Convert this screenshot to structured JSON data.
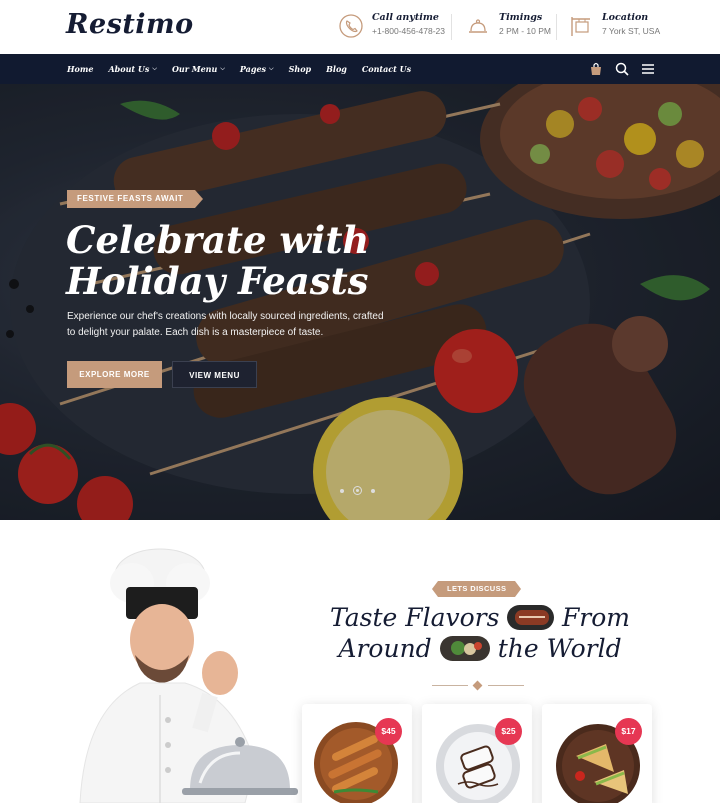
{
  "brand": {
    "logo": "Restimo"
  },
  "contact": [
    {
      "icon": "phone-icon",
      "title": "Call anytime",
      "value": "+1-800-456-478-23"
    },
    {
      "icon": "cloche-icon",
      "title": "Timings",
      "value": "2 PM - 10 PM"
    },
    {
      "icon": "signboard-icon",
      "title": "Location",
      "value": "7 York ST, USA"
    }
  ],
  "nav": {
    "items": [
      {
        "label": "Home",
        "has_dropdown": false
      },
      {
        "label": "About Us",
        "has_dropdown": true
      },
      {
        "label": "Our Menu",
        "has_dropdown": true
      },
      {
        "label": "Pages",
        "has_dropdown": true
      },
      {
        "label": "Shop",
        "has_dropdown": false
      },
      {
        "label": "Blog",
        "has_dropdown": false
      },
      {
        "label": "Contact Us",
        "has_dropdown": false
      }
    ],
    "tools": [
      "cart-icon",
      "search-icon",
      "menu-icon"
    ],
    "background": "#111a30"
  },
  "hero": {
    "badge": "FESTIVE FEASTS AWAIT",
    "title_line1": "Celebrate with",
    "title_line2": "Holiday Feasts",
    "description": "Experience our chef's creations with locally sourced ingredients, crafted to delight your palate. Each dish is a masterpiece of taste.",
    "primary_button": "EXPLORE MORE",
    "secondary_button": "VIEW MENU",
    "slides_total": 3,
    "active_slide": 2
  },
  "section": {
    "tag": "LETS DISCUSS",
    "title_part1": "Taste Flavors",
    "title_part2": "From",
    "title_part3": "Around",
    "title_part4": "the World"
  },
  "cards": [
    {
      "price": "$45",
      "dish": "grilled-skewers-plate"
    },
    {
      "price": "$25",
      "dish": "dessert-plate"
    },
    {
      "price": "$17",
      "dish": "sandwich-plate"
    }
  ],
  "colors": {
    "accent": "#c59b7c",
    "dark": "#151c33",
    "price_badge": "#e63753"
  }
}
